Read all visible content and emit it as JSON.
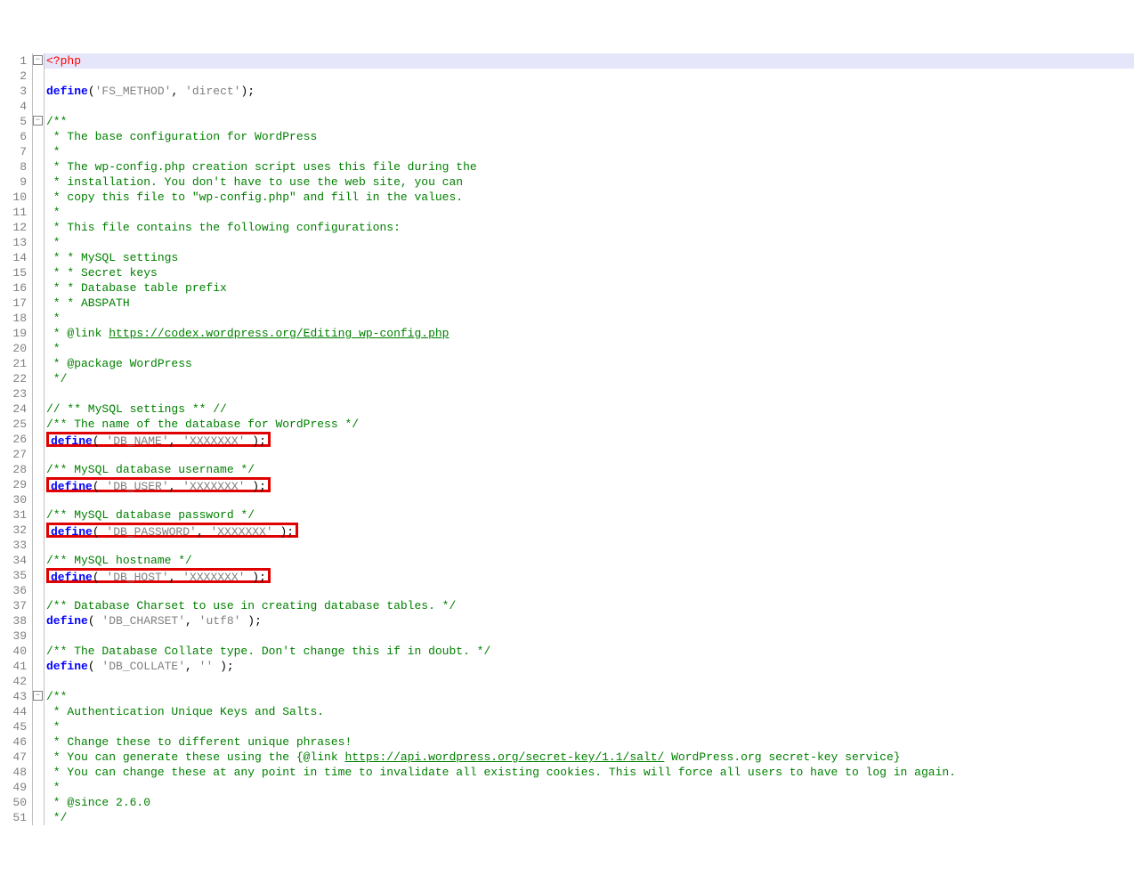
{
  "fold_symbol": "−",
  "lines": [
    {
      "n": 1,
      "highlight": true,
      "fold": true,
      "tokens": [
        {
          "t": "<?php",
          "c": "k-php"
        }
      ]
    },
    {
      "n": 2,
      "tokens": []
    },
    {
      "n": 3,
      "tokens": [
        {
          "t": "define",
          "c": "k-define"
        },
        {
          "t": "(",
          "c": "k-punct"
        },
        {
          "t": "'FS_METHOD'",
          "c": "k-str"
        },
        {
          "t": ", ",
          "c": "k-punct"
        },
        {
          "t": "'direct'",
          "c": "k-str"
        },
        {
          "t": ");",
          "c": "k-punct"
        }
      ]
    },
    {
      "n": 4,
      "tokens": []
    },
    {
      "n": 5,
      "fold": true,
      "tokens": [
        {
          "t": "/**",
          "c": "k-comment"
        }
      ]
    },
    {
      "n": 6,
      "tokens": [
        {
          "t": " * The base configuration for WordPress",
          "c": "k-comment"
        }
      ]
    },
    {
      "n": 7,
      "tokens": [
        {
          "t": " *",
          "c": "k-comment"
        }
      ]
    },
    {
      "n": 8,
      "tokens": [
        {
          "t": " * The wp-config.php creation script uses this file during the",
          "c": "k-comment"
        }
      ]
    },
    {
      "n": 9,
      "tokens": [
        {
          "t": " * installation. You don't have to use the web site, you can",
          "c": "k-comment"
        }
      ]
    },
    {
      "n": 10,
      "tokens": [
        {
          "t": " * copy this file to \"wp-config.php\" and fill in the values.",
          "c": "k-comment"
        }
      ]
    },
    {
      "n": 11,
      "tokens": [
        {
          "t": " *",
          "c": "k-comment"
        }
      ]
    },
    {
      "n": 12,
      "tokens": [
        {
          "t": " * This file contains the following configurations:",
          "c": "k-comment"
        }
      ]
    },
    {
      "n": 13,
      "tokens": [
        {
          "t": " *",
          "c": "k-comment"
        }
      ]
    },
    {
      "n": 14,
      "tokens": [
        {
          "t": " * * MySQL settings",
          "c": "k-comment"
        }
      ]
    },
    {
      "n": 15,
      "tokens": [
        {
          "t": " * * Secret keys",
          "c": "k-comment"
        }
      ]
    },
    {
      "n": 16,
      "tokens": [
        {
          "t": " * * Database table prefix",
          "c": "k-comment"
        }
      ]
    },
    {
      "n": 17,
      "tokens": [
        {
          "t": " * * ABSPATH",
          "c": "k-comment"
        }
      ]
    },
    {
      "n": 18,
      "tokens": [
        {
          "t": " *",
          "c": "k-comment"
        }
      ]
    },
    {
      "n": 19,
      "tokens": [
        {
          "t": " * @link ",
          "c": "k-comment"
        },
        {
          "t": "https://codex.wordpress.org/Editing_wp-config.php",
          "c": "k-link"
        }
      ]
    },
    {
      "n": 20,
      "tokens": [
        {
          "t": " *",
          "c": "k-comment"
        }
      ]
    },
    {
      "n": 21,
      "tokens": [
        {
          "t": " * @package WordPress",
          "c": "k-comment"
        }
      ]
    },
    {
      "n": 22,
      "tokens": [
        {
          "t": " */",
          "c": "k-comment"
        }
      ]
    },
    {
      "n": 23,
      "tokens": []
    },
    {
      "n": 24,
      "tokens": [
        {
          "t": "// ** MySQL settings ** //",
          "c": "k-comment"
        }
      ]
    },
    {
      "n": 25,
      "tokens": [
        {
          "t": "/** The name of the database for WordPress */",
          "c": "k-comment"
        }
      ]
    },
    {
      "n": 26,
      "redbox": true,
      "tokens": [
        {
          "t": "define",
          "c": "k-define"
        },
        {
          "t": "( ",
          "c": "k-punct"
        },
        {
          "t": "'DB_NAME'",
          "c": "k-str"
        },
        {
          "t": ", ",
          "c": "k-punct"
        },
        {
          "t": "'XXXXXXX'",
          "c": "k-str"
        },
        {
          "t": " );",
          "c": "k-punct"
        }
      ]
    },
    {
      "n": 27,
      "tokens": []
    },
    {
      "n": 28,
      "tokens": [
        {
          "t": "/** MySQL database username */",
          "c": "k-comment"
        }
      ]
    },
    {
      "n": 29,
      "redbox": true,
      "tokens": [
        {
          "t": "define",
          "c": "k-define"
        },
        {
          "t": "( ",
          "c": "k-punct"
        },
        {
          "t": "'DB_USER'",
          "c": "k-str"
        },
        {
          "t": ", ",
          "c": "k-punct"
        },
        {
          "t": "'XXXXXXX'",
          "c": "k-str"
        },
        {
          "t": " );",
          "c": "k-punct"
        }
      ]
    },
    {
      "n": 30,
      "tokens": []
    },
    {
      "n": 31,
      "tokens": [
        {
          "t": "/** MySQL database password */",
          "c": "k-comment"
        }
      ]
    },
    {
      "n": 32,
      "redbox": true,
      "tokens": [
        {
          "t": "define",
          "c": "k-define"
        },
        {
          "t": "( ",
          "c": "k-punct"
        },
        {
          "t": "'DB_PASSWORD'",
          "c": "k-str"
        },
        {
          "t": ", ",
          "c": "k-punct"
        },
        {
          "t": "'XXXXXXX'",
          "c": "k-str"
        },
        {
          "t": " );",
          "c": "k-punct"
        }
      ]
    },
    {
      "n": 33,
      "tokens": []
    },
    {
      "n": 34,
      "tokens": [
        {
          "t": "/** MySQL hostname */",
          "c": "k-comment"
        }
      ]
    },
    {
      "n": 35,
      "redbox": true,
      "tokens": [
        {
          "t": "define",
          "c": "k-define"
        },
        {
          "t": "( ",
          "c": "k-punct"
        },
        {
          "t": "'DB_HOST'",
          "c": "k-str"
        },
        {
          "t": ", ",
          "c": "k-punct"
        },
        {
          "t": "'XXXXXXX'",
          "c": "k-str"
        },
        {
          "t": " );",
          "c": "k-punct"
        }
      ]
    },
    {
      "n": 36,
      "tokens": []
    },
    {
      "n": 37,
      "tokens": [
        {
          "t": "/** Database Charset to use in creating database tables. */",
          "c": "k-comment"
        }
      ]
    },
    {
      "n": 38,
      "tokens": [
        {
          "t": "define",
          "c": "k-define"
        },
        {
          "t": "( ",
          "c": "k-punct"
        },
        {
          "t": "'DB_CHARSET'",
          "c": "k-str"
        },
        {
          "t": ", ",
          "c": "k-punct"
        },
        {
          "t": "'utf8'",
          "c": "k-str"
        },
        {
          "t": " );",
          "c": "k-punct"
        }
      ]
    },
    {
      "n": 39,
      "tokens": []
    },
    {
      "n": 40,
      "tokens": [
        {
          "t": "/** The Database Collate type. Don't change this if in doubt. */",
          "c": "k-comment"
        }
      ]
    },
    {
      "n": 41,
      "tokens": [
        {
          "t": "define",
          "c": "k-define"
        },
        {
          "t": "( ",
          "c": "k-punct"
        },
        {
          "t": "'DB_COLLATE'",
          "c": "k-str"
        },
        {
          "t": ", ",
          "c": "k-punct"
        },
        {
          "t": "''",
          "c": "k-str"
        },
        {
          "t": " );",
          "c": "k-punct"
        }
      ]
    },
    {
      "n": 42,
      "tokens": []
    },
    {
      "n": 43,
      "fold": true,
      "tokens": [
        {
          "t": "/**",
          "c": "k-comment"
        }
      ]
    },
    {
      "n": 44,
      "tokens": [
        {
          "t": " * Authentication Unique Keys and Salts.",
          "c": "k-comment"
        }
      ]
    },
    {
      "n": 45,
      "tokens": [
        {
          "t": " *",
          "c": "k-comment"
        }
      ]
    },
    {
      "n": 46,
      "tokens": [
        {
          "t": " * Change these to different unique phrases!",
          "c": "k-comment"
        }
      ]
    },
    {
      "n": 47,
      "tokens": [
        {
          "t": " * You can generate these using the {@link ",
          "c": "k-comment"
        },
        {
          "t": "https://api.wordpress.org/secret-key/1.1/salt/",
          "c": "k-link"
        },
        {
          "t": " WordPress.org secret-key service}",
          "c": "k-comment"
        }
      ]
    },
    {
      "n": 48,
      "tokens": [
        {
          "t": " * You can change these at any point in time to invalidate all existing cookies. This will force all users to have to log in again.",
          "c": "k-comment"
        }
      ]
    },
    {
      "n": 49,
      "tokens": [
        {
          "t": " *",
          "c": "k-comment"
        }
      ]
    },
    {
      "n": 50,
      "tokens": [
        {
          "t": " * @since 2.6.0",
          "c": "k-comment"
        }
      ]
    },
    {
      "n": 51,
      "tokens": [
        {
          "t": " */",
          "c": "k-comment"
        }
      ]
    }
  ]
}
